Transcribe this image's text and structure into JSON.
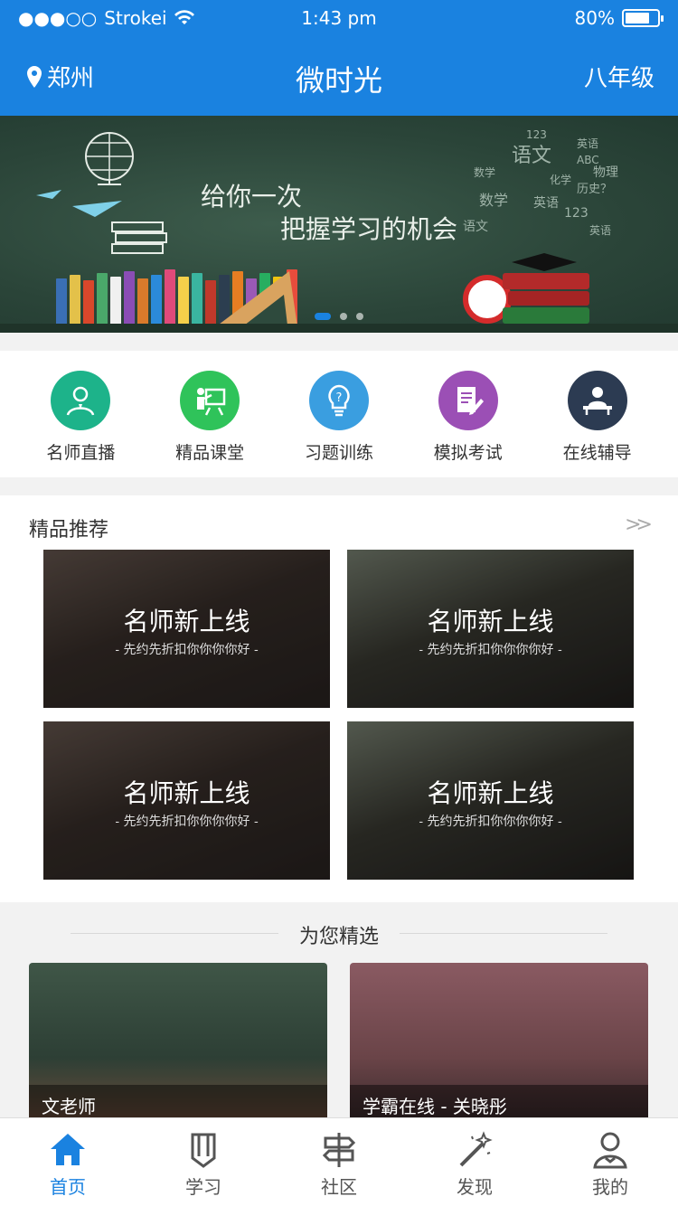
{
  "status": {
    "carrier": "Strokei",
    "time": "1:43 pm",
    "battery": "80%",
    "battery_level": 0.8
  },
  "nav": {
    "location": "郑州",
    "title": "微时光",
    "grade": "八年级"
  },
  "banner": {
    "line1": "给你一次",
    "line2": "把握学习的机会",
    "subjects": [
      "123",
      "语文",
      "英语",
      "ABC",
      "数学",
      "化学",
      "物理",
      "历史？",
      "数学",
      "英语",
      "123",
      "语文",
      "英语"
    ],
    "slides": 3,
    "active_slide": 0
  },
  "quick": [
    {
      "label": "名师直播",
      "icon": "teacher-icon",
      "color": "#1db38a"
    },
    {
      "label": "精品课堂",
      "icon": "classroom-icon",
      "color": "#2fc35a"
    },
    {
      "label": "习题训练",
      "icon": "lightbulb-icon",
      "color": "#3a9ee0"
    },
    {
      "label": "模拟考试",
      "icon": "exam-icon",
      "color": "#9b4fb5"
    },
    {
      "label": "在线辅导",
      "icon": "tutor-icon",
      "color": "#2c3b52"
    }
  ],
  "recommend": {
    "title": "精品推荐",
    "more": "»",
    "cards": [
      {
        "title": "名师新上线",
        "subtitle": "- 先约先折扣你你你你好 -"
      },
      {
        "title": "名师新上线",
        "subtitle": "- 先约先折扣你你你你好 -"
      },
      {
        "title": "名师新上线",
        "subtitle": "- 先约先折扣你你你你好 -"
      },
      {
        "title": "名师新上线",
        "subtitle": "- 先约先折扣你你你你好 -"
      }
    ]
  },
  "foryou": {
    "title": "为您精选",
    "items": [
      {
        "caption": "文老师"
      },
      {
        "caption": "学霸在线 - 关晓彤"
      }
    ]
  },
  "tabs": [
    {
      "label": "首页",
      "icon": "home-icon",
      "active": true
    },
    {
      "label": "学习",
      "icon": "pencil-icon",
      "active": false
    },
    {
      "label": "社区",
      "icon": "signpost-icon",
      "active": false
    },
    {
      "label": "发现",
      "icon": "magic-wand-icon",
      "active": false
    },
    {
      "label": "我的",
      "icon": "user-icon",
      "active": false
    }
  ],
  "colors": {
    "primary": "#1a82e0",
    "tab_inactive": "#555555"
  }
}
